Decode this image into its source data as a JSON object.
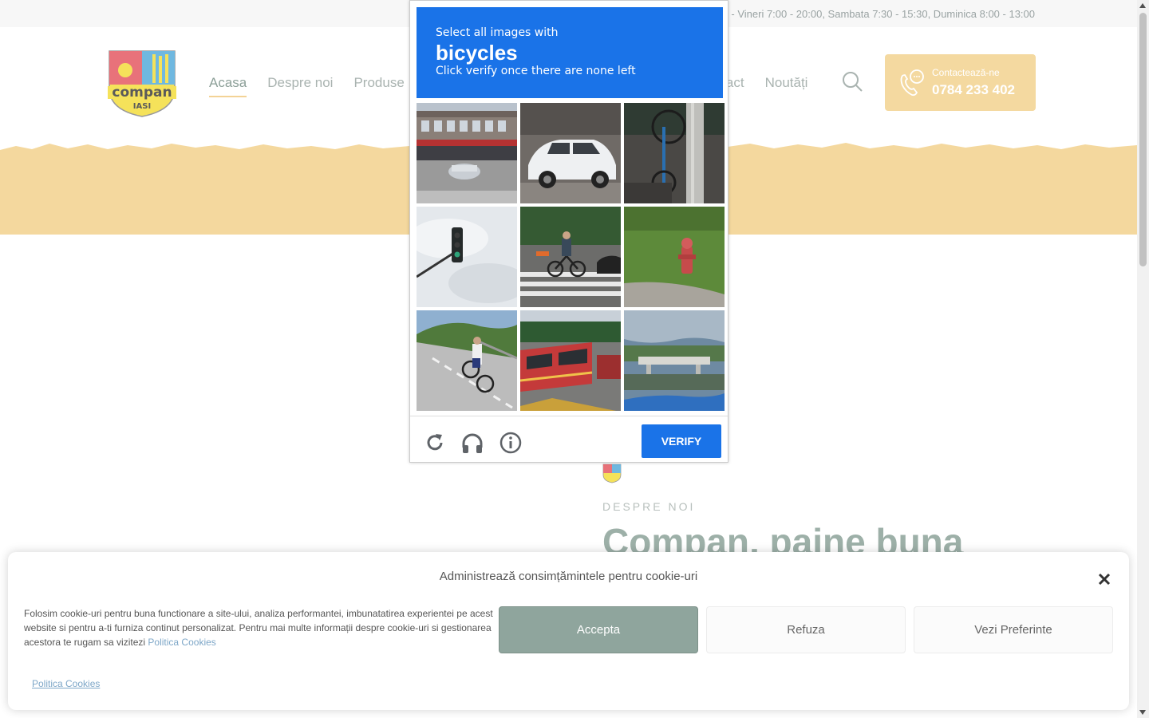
{
  "topbar": {
    "hours": "Luni - Vineri 7:00 - 20:00, Sambata 7:30 - 15:30, Duminica 8:00 - 13:00"
  },
  "header": {
    "logo_text": "compan",
    "logo_city": "IASI",
    "nav_left": [
      "Acasa",
      "Despre noi",
      "Produse"
    ],
    "nav_right": [
      "Contact",
      "Noutăți"
    ],
    "contact_label": "Contactează-ne",
    "contact_phone": "0784 233 402"
  },
  "captcha": {
    "line1": "Select all images with",
    "target": "bicycles",
    "line3": "Click verify once there are none left",
    "verify_label": "VERIFY",
    "tiles": [
      "storefront-street",
      "white-car",
      "bicycle-by-pole",
      "traffic-light",
      "cyclist-crosswalk",
      "fire-hydrant",
      "cyclist-mountain-road",
      "red-bus",
      "bridge-river"
    ]
  },
  "about": {
    "kicker": "DESPRE NOI",
    "title": "Compan, paine buna"
  },
  "cookie": {
    "title": "Administrează consimțămintele pentru cookie-uri",
    "text": "Folosim cookie-uri pentru buna functionare a site-ului, analiza performantei, imbunatatirea experientei pe acest website si pentru a-ti furniza continut personalizat. Pentru mai multe informații despre cookie-uri si gestionarea acestora te rugam sa vizitezi",
    "text_link": "Politica Cookies",
    "accept": "Accepta",
    "refuse": "Refuza",
    "prefs": "Vezi Preferinte",
    "policy_link": "Politica Cookies"
  },
  "colors": {
    "accent_sage": "#8fa59d",
    "band_yellow": "#f4d89e",
    "captcha_blue": "#1a73e8"
  }
}
